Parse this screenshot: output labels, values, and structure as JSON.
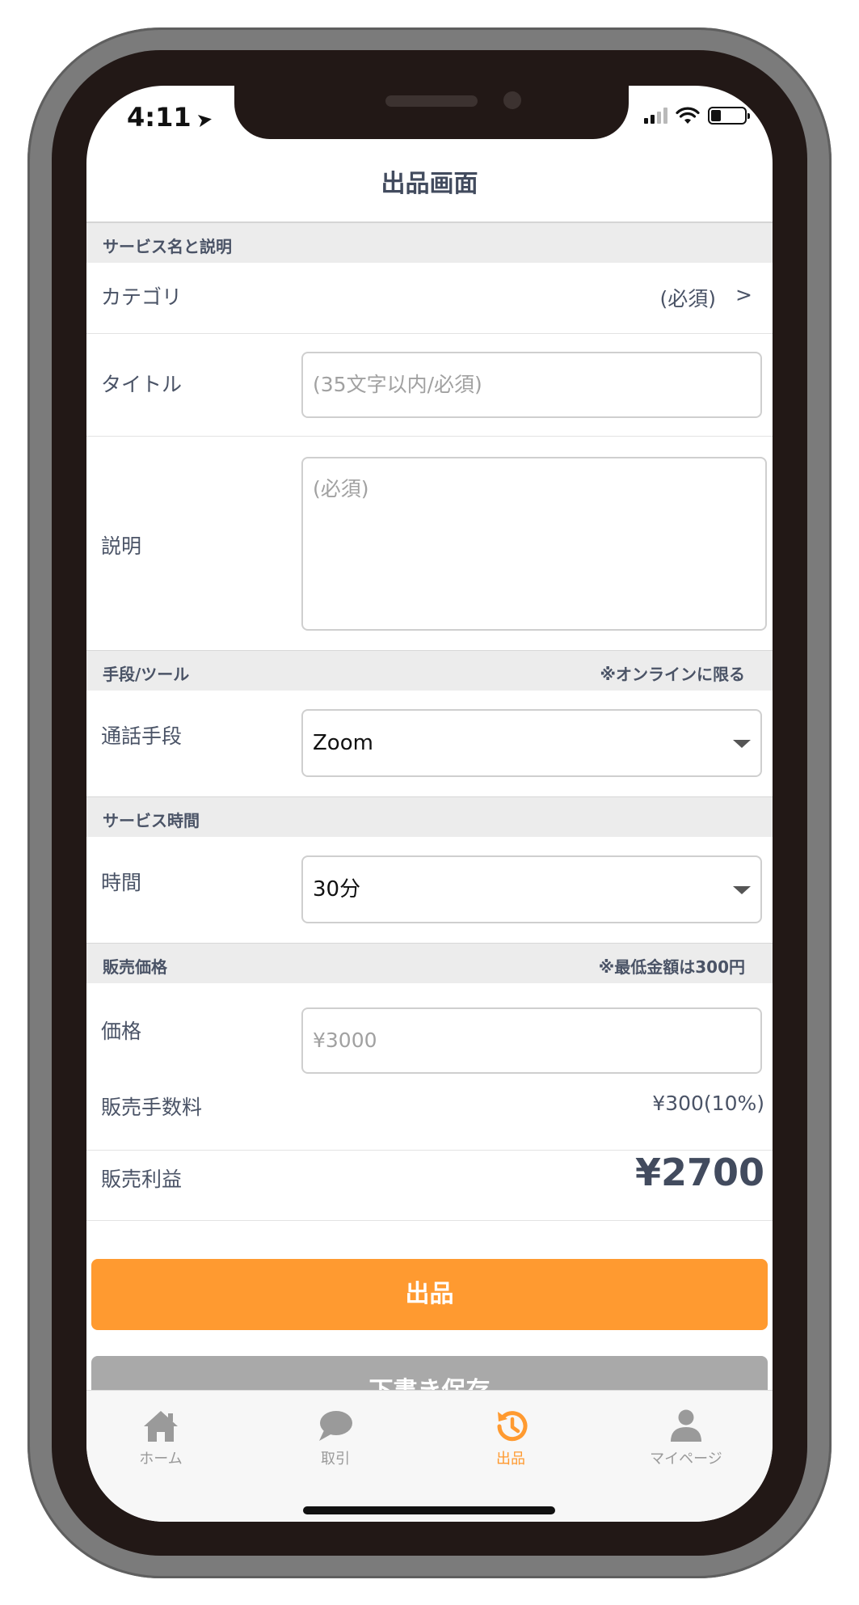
{
  "status_bar": {
    "time": "4:11"
  },
  "nav": {
    "title": "出品画面"
  },
  "sections": {
    "service": {
      "title": "サービス名と説明"
    },
    "tool": {
      "title": "手段/ツール",
      "note": "※オンラインに限る"
    },
    "time": {
      "title": "サービス時間"
    },
    "price": {
      "title": "販売価格",
      "note": "※最低金額は300円"
    }
  },
  "form": {
    "category": {
      "label": "カテゴリ",
      "value": "(必須)",
      "chevron": ">"
    },
    "title": {
      "label": "タイトル",
      "placeholder": "(35文字以内/必須)"
    },
    "description": {
      "label": "説明",
      "placeholder": "(必須)"
    },
    "call_method": {
      "label": "通話手段",
      "value": "Zoom"
    },
    "duration": {
      "label": "時間",
      "value": "30分"
    },
    "price": {
      "label": "価格",
      "placeholder": "¥3000"
    },
    "fee": {
      "label": "販売手数料",
      "value": "¥300(10%)"
    },
    "profit": {
      "label": "販売利益",
      "value": "¥2700"
    }
  },
  "buttons": {
    "submit": "出品",
    "draft": "下書き保存"
  },
  "tabs": [
    {
      "label": "ホーム",
      "icon": "home-icon"
    },
    {
      "label": "取引",
      "icon": "chat-bubble-icon"
    },
    {
      "label": "出品",
      "icon": "history-icon",
      "active": true
    },
    {
      "label": "マイページ",
      "icon": "user-icon"
    }
  ],
  "colors": {
    "accent": "#ff9a30",
    "text": "#4a5366",
    "section_bg": "#ececec"
  }
}
